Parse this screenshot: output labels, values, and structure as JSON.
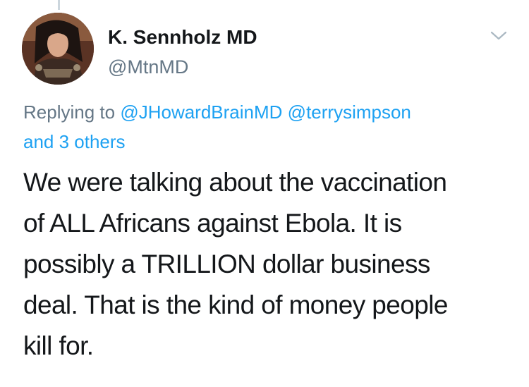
{
  "author": {
    "name": "K. Sennholz MD",
    "handle": "@MtnMD",
    "avatar_icon": "profile-photo"
  },
  "menu": {
    "icon": "chevron-down-icon"
  },
  "reply": {
    "prefix": "Replying to",
    "mentions": [
      "@JHowardBrainMD",
      "@terrysimpson"
    ],
    "others": "and 3 others"
  },
  "tweet": {
    "lines": [
      "We were talking about the vaccination",
      "of ALL Africans against Ebola. It is",
      "possibly a TRILLION dollar business",
      "deal. That is the kind of money people",
      "kill for."
    ]
  },
  "colors": {
    "link": "#1da1f2",
    "secondary_text": "#657786",
    "primary_text": "#14171a",
    "thread_line": "#ccd6dd"
  }
}
